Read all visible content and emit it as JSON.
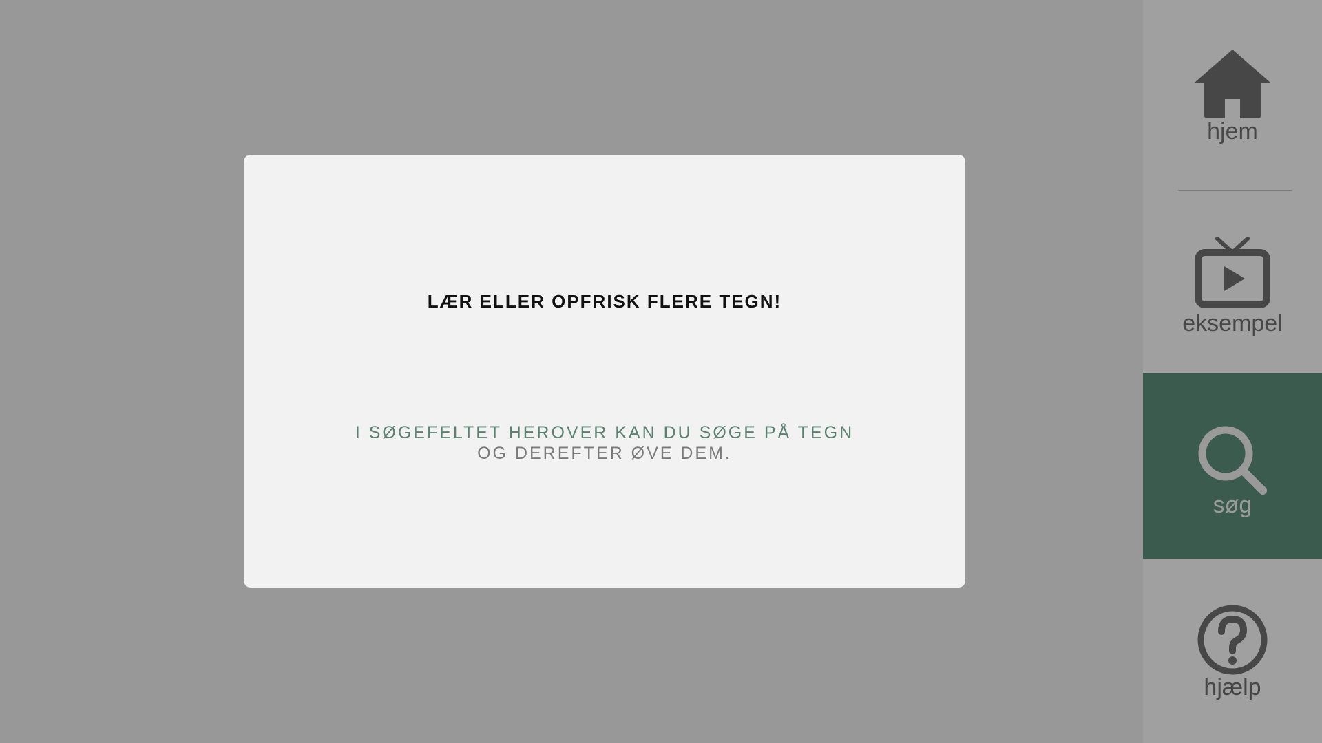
{
  "modal": {
    "title": "LÆR ELLER OPFRISK FLERE TEGN!",
    "line1": "I SØGEFELTET HEROVER KAN DU SØGE PÅ TEGN",
    "line2": "OG DEREFTER ØVE DEM."
  },
  "sidebar": {
    "items": [
      {
        "label": "hjem",
        "icon": "home-icon"
      },
      {
        "label": "eksempel",
        "icon": "tv-play-icon"
      },
      {
        "label": "søg",
        "icon": "search-icon",
        "active": true
      },
      {
        "label": "hjælp",
        "icon": "help-icon"
      }
    ]
  },
  "colors": {
    "background": "#989898",
    "modal": "#f2f2f2",
    "sidebar": "#a0a0a0",
    "active": "#3a5b4d",
    "icon": "#474747",
    "accent_text": "#5b8270"
  }
}
